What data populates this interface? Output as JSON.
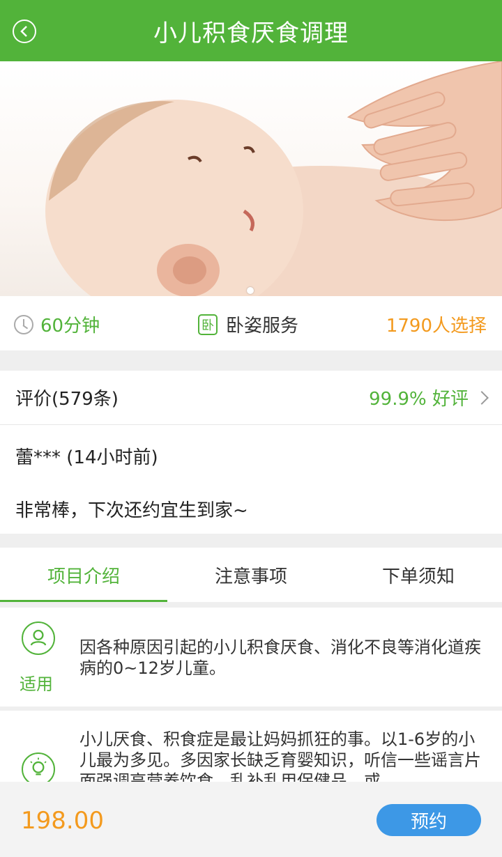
{
  "header": {
    "title": "小儿积食厌食调理"
  },
  "info": {
    "duration": "60分钟",
    "position": "卧姿服务",
    "position_icon_char": "卧",
    "selections": "1790人选择"
  },
  "review": {
    "heading": "评价(579条)",
    "rating": "99.9% 好评",
    "user": "蕾*** (14小时前)",
    "text": "非常棒，下次还约宜生到家~"
  },
  "tabs": [
    {
      "label": "项目介绍",
      "active": true
    },
    {
      "label": "注意事项",
      "active": false
    },
    {
      "label": "下单须知",
      "active": false
    }
  ],
  "sections": {
    "suitable_label": "适用",
    "suitable_text": "因各种原因引起的小儿积食厌食、消化不良等消化道疾病的0~12岁儿童。",
    "intro_text": "小儿厌食、积食症是最让妈妈抓狂的事。以1-6岁的小儿最为多见。多因家长缺乏育婴知识，听信一些谣言片面强调高营养饮食，乱补乱用保健品，或"
  },
  "footer": {
    "price": "198.00",
    "book_label": "预约"
  },
  "colors": {
    "brand_green": "#52b33a",
    "accent_orange": "#f39a1e",
    "button_blue": "#3d98e6"
  },
  "icons": [
    "back-icon",
    "clock-icon",
    "lie-down-icon",
    "chevron-right-icon",
    "person-icon",
    "lightbulb-icon"
  ]
}
